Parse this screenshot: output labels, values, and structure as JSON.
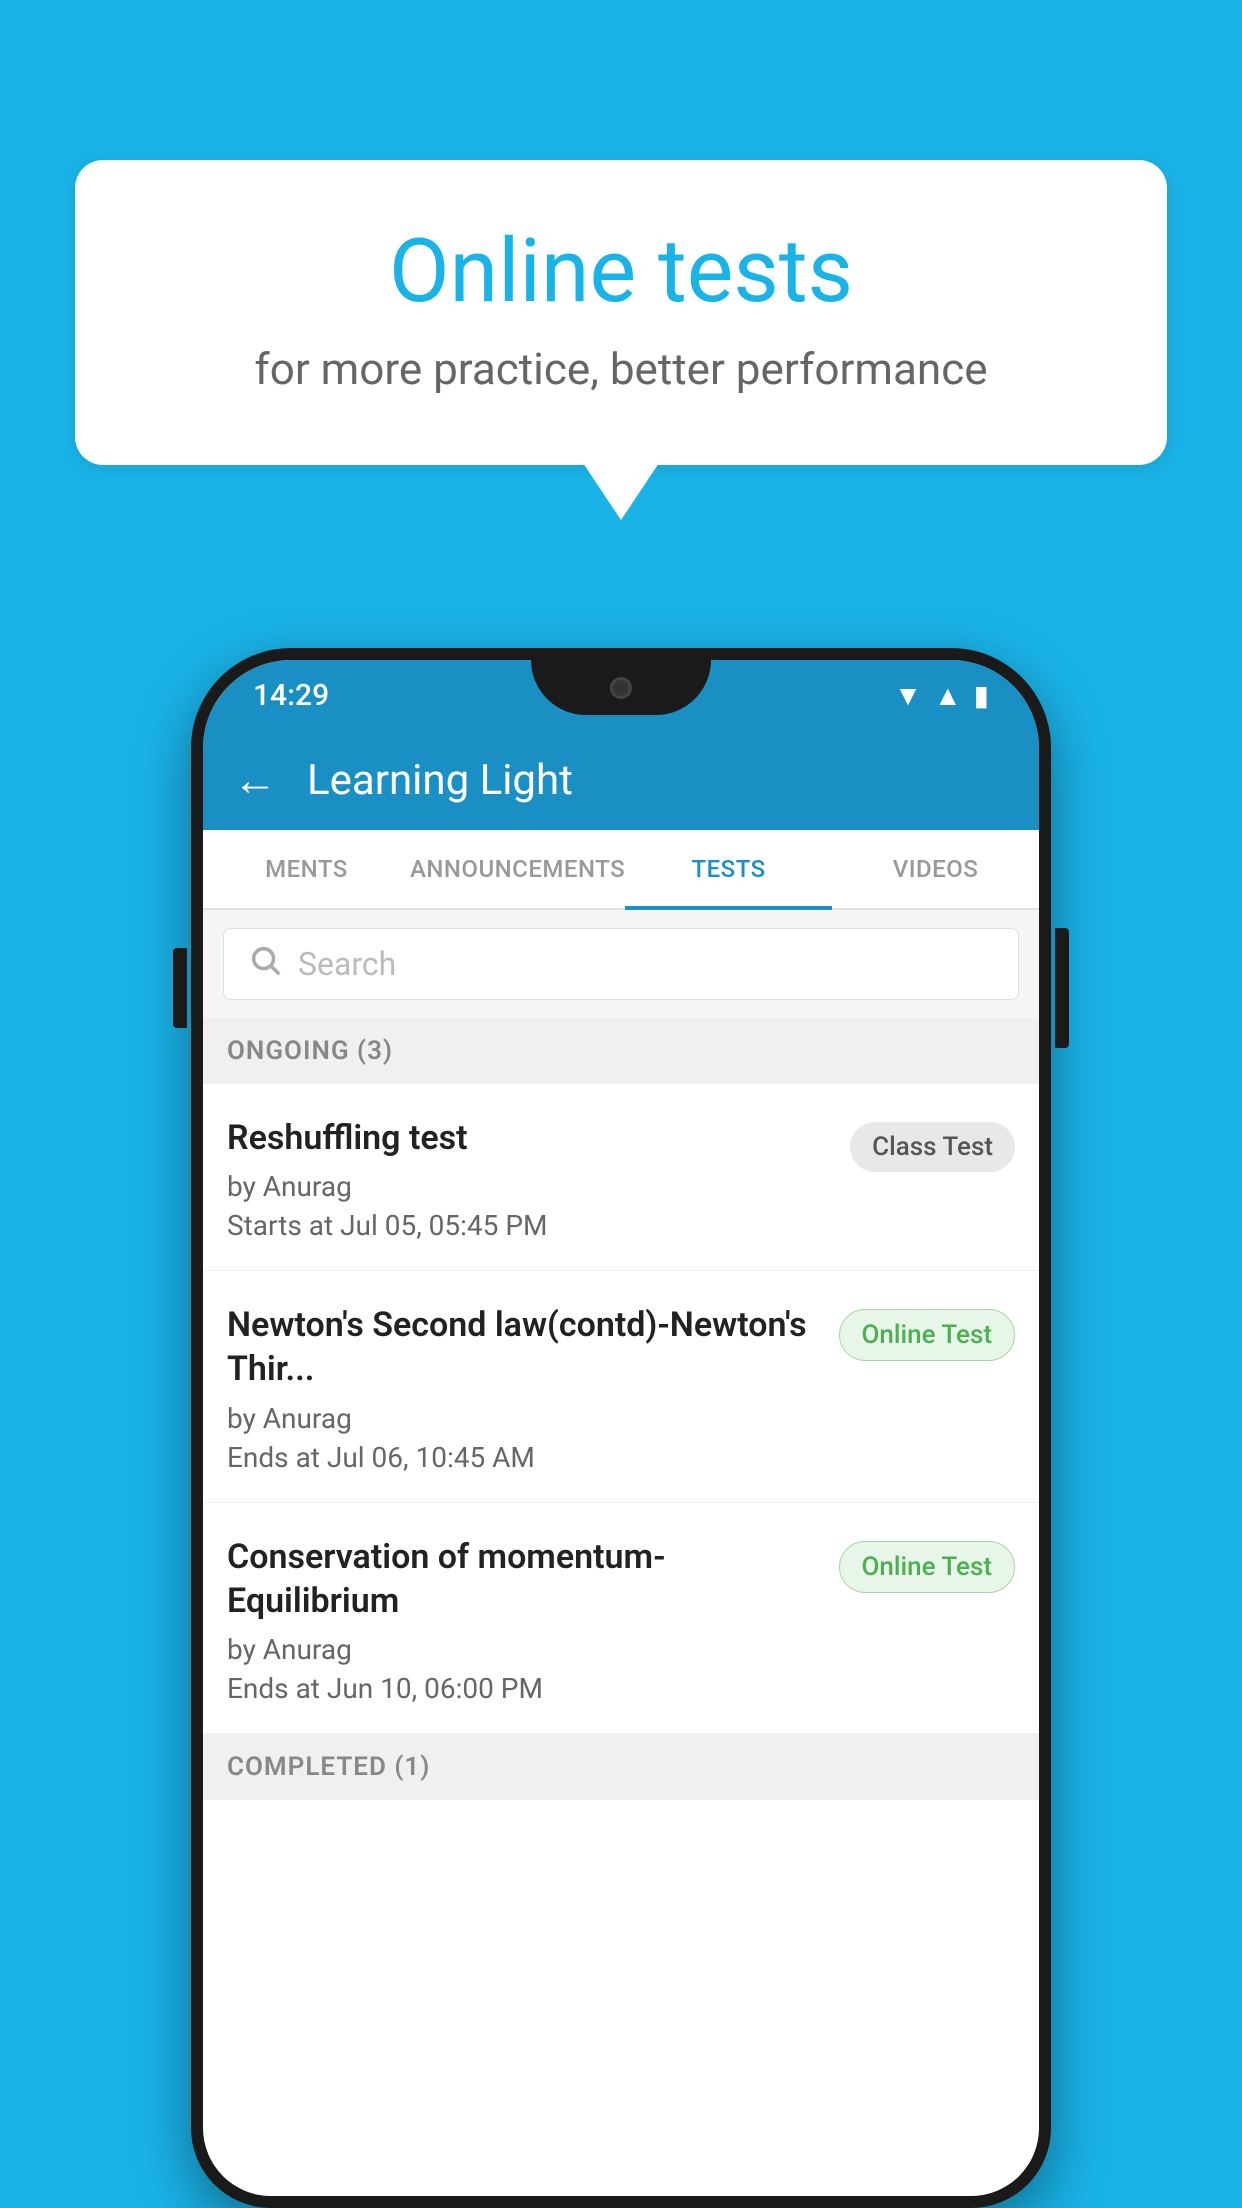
{
  "background_color": "#1ab3e8",
  "speech_bubble": {
    "title": "Online tests",
    "subtitle": "for more practice, better performance"
  },
  "phone": {
    "status_bar": {
      "time": "14:29",
      "icons": [
        "wifi",
        "signal",
        "battery"
      ]
    },
    "app_bar": {
      "title": "Learning Light",
      "back_label": "←"
    },
    "tabs": [
      {
        "label": "MENTS",
        "active": false
      },
      {
        "label": "ANNOUNCEMENTS",
        "active": false
      },
      {
        "label": "TESTS",
        "active": true
      },
      {
        "label": "VIDEOS",
        "active": false
      }
    ],
    "search": {
      "placeholder": "Search"
    },
    "sections": [
      {
        "title": "ONGOING (3)",
        "tests": [
          {
            "name": "Reshuffling test",
            "author": "by Anurag",
            "time": "Starts at  Jul 05, 05:45 PM",
            "badge": "Class Test",
            "badge_type": "class"
          },
          {
            "name": "Newton's Second law(contd)-Newton's Thir...",
            "author": "by Anurag",
            "time": "Ends at  Jul 06, 10:45 AM",
            "badge": "Online Test",
            "badge_type": "online"
          },
          {
            "name": "Conservation of momentum-Equilibrium",
            "author": "by Anurag",
            "time": "Ends at  Jun 10, 06:00 PM",
            "badge": "Online Test",
            "badge_type": "online"
          }
        ]
      }
    ],
    "completed_section": {
      "title": "COMPLETED (1)"
    }
  }
}
